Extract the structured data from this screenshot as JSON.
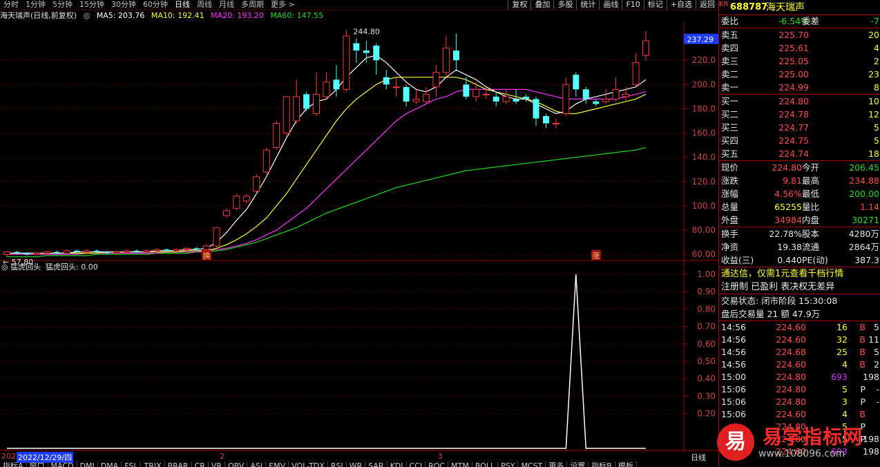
{
  "toolbar": {
    "periods": [
      "分时",
      "1分钟",
      "5分钟",
      "15分钟",
      "30分钟",
      "60分钟",
      "日线",
      "周线",
      "月线",
      "多周期",
      "更多 >"
    ],
    "active_period": "日线",
    "right_buttons": [
      "复权",
      "叠加",
      "多股",
      "统计",
      "画线",
      "F10",
      "标记",
      "+自选",
      "返回"
    ]
  },
  "ma_header": {
    "title": "海天瑞声(日线,前复权)",
    "ma5": "MA5: 203.76",
    "ma10": "MA10: 192.41",
    "ma20": "MA20: 193.20",
    "ma60": "MA60: 147.55",
    "colors": {
      "ma5": "#ffffff",
      "ma10": "#ffff33",
      "ma20": "#ff33ff",
      "ma60": "#22dd22"
    }
  },
  "chart_data": {
    "type": "candlestick",
    "y_axis_ticks": [
      "220.0",
      "200.0",
      "180.0",
      "160.0",
      "140.0",
      "120.0",
      "100.0",
      "80.00",
      "60.00"
    ],
    "current_price_tag": "237.29",
    "high_label": "244.80",
    "low_label": "57.80",
    "markers": [
      "换",
      "涨"
    ],
    "candles": [
      [
        60,
        62,
        57.8,
        63
      ],
      [
        62,
        61,
        60,
        63
      ],
      [
        61,
        60,
        59,
        62
      ],
      [
        60,
        61,
        59,
        62
      ],
      [
        61,
        62,
        60,
        63
      ],
      [
        62,
        61,
        60,
        63
      ],
      [
        61,
        63,
        60,
        64
      ],
      [
        63,
        62,
        61,
        64
      ],
      [
        62,
        63,
        61,
        64
      ],
      [
        63,
        62,
        61,
        64
      ],
      [
        62,
        61,
        60,
        63
      ],
      [
        61,
        62,
        60,
        63
      ],
      [
        62,
        63,
        61,
        64
      ],
      [
        63,
        62,
        61,
        64
      ],
      [
        62,
        63,
        61,
        64
      ],
      [
        63,
        64,
        62,
        65
      ],
      [
        64,
        63,
        62,
        65
      ],
      [
        63,
        64,
        62,
        65
      ],
      [
        64,
        65,
        63,
        66
      ],
      [
        65,
        64,
        63,
        66
      ],
      [
        64,
        67,
        63,
        68
      ],
      [
        67,
        82,
        66,
        82
      ],
      [
        92,
        96,
        90,
        98
      ],
      [
        98,
        108,
        96,
        110
      ],
      [
        104,
        108,
        102,
        110
      ],
      [
        112,
        124,
        110,
        126
      ],
      [
        128,
        146,
        126,
        148
      ],
      [
        148,
        168,
        146,
        170
      ],
      [
        160,
        190,
        158,
        190
      ],
      [
        170,
        190,
        168,
        204
      ],
      [
        192,
        180,
        178,
        194
      ],
      [
        176,
        192,
        174,
        210
      ],
      [
        190,
        202,
        188,
        210
      ],
      [
        204,
        196,
        190,
        216
      ],
      [
        196,
        240,
        194,
        244.8
      ],
      [
        234,
        228,
        218,
        238
      ],
      [
        228,
        226,
        218,
        236
      ],
      [
        232,
        220,
        208,
        234
      ],
      [
        206,
        200,
        196,
        212
      ],
      [
        198,
        198,
        190,
        206
      ],
      [
        198,
        186,
        182,
        200
      ],
      [
        186,
        188,
        184,
        196
      ],
      [
        186,
        192,
        184,
        198
      ],
      [
        198,
        210,
        190,
        216
      ],
      [
        210,
        230,
        206,
        240
      ],
      [
        228,
        220,
        212,
        242
      ],
      [
        200,
        190,
        188,
        206
      ],
      [
        190,
        196,
        186,
        202
      ],
      [
        192,
        192,
        188,
        198
      ],
      [
        190,
        186,
        182,
        194
      ],
      [
        186,
        190,
        184,
        196
      ],
      [
        188,
        186,
        184,
        196
      ],
      [
        190,
        188,
        186,
        192
      ],
      [
        188,
        172,
        166,
        190
      ],
      [
        174,
        168,
        164,
        176
      ],
      [
        168,
        168,
        164,
        172
      ],
      [
        176,
        200,
        174,
        206
      ],
      [
        208,
        196,
        190,
        210
      ],
      [
        196,
        188,
        184,
        198
      ],
      [
        186,
        184,
        182,
        188
      ],
      [
        186,
        188,
        184,
        196
      ],
      [
        188,
        196,
        186,
        206
      ],
      [
        190,
        192,
        186,
        198
      ],
      [
        200,
        218,
        198,
        226
      ],
      [
        224,
        236,
        220,
        244
      ]
    ],
    "ma5": [
      61,
      61,
      61,
      61,
      61,
      61,
      61,
      62,
      62,
      62,
      62,
      62,
      62,
      62,
      62,
      63,
      63,
      63,
      64,
      64,
      65,
      70,
      78,
      88,
      97,
      110,
      124,
      140,
      156,
      170,
      180,
      186,
      188,
      196,
      206,
      214,
      222,
      224,
      218,
      210,
      202,
      196,
      194,
      198,
      206,
      212,
      208,
      204,
      198,
      194,
      190,
      188,
      188,
      184,
      180,
      176,
      178,
      184,
      188,
      190,
      192,
      194,
      196,
      198,
      204
    ],
    "ma10": [
      61,
      61,
      61,
      61,
      61,
      61,
      61,
      61,
      61,
      61,
      62,
      62,
      62,
      62,
      62,
      62,
      62,
      62,
      63,
      63,
      63,
      65,
      68,
      72,
      77,
      83,
      90,
      100,
      110,
      122,
      134,
      146,
      158,
      170,
      180,
      188,
      194,
      200,
      204,
      206,
      206,
      206,
      206,
      206,
      206,
      206,
      204,
      200,
      196,
      194,
      192,
      190,
      188,
      186,
      182,
      178,
      176,
      176,
      178,
      180,
      182,
      184,
      186,
      188,
      192
    ],
    "ma20": [
      60,
      60,
      60,
      60,
      60,
      60,
      60,
      60,
      61,
      61,
      61,
      61,
      61,
      61,
      61,
      61,
      62,
      62,
      62,
      62,
      63,
      64,
      65,
      67,
      69,
      72,
      76,
      80,
      86,
      92,
      98,
      106,
      114,
      122,
      130,
      138,
      146,
      154,
      162,
      170,
      176,
      180,
      184,
      188,
      190,
      194,
      196,
      196,
      196,
      196,
      196,
      196,
      196,
      194,
      192,
      190,
      188,
      188,
      188,
      188,
      188,
      188,
      190,
      192,
      194
    ],
    "ma60": [
      58,
      58,
      58,
      58,
      59,
      59,
      59,
      59,
      59,
      60,
      60,
      60,
      60,
      60,
      60,
      61,
      61,
      61,
      61,
      62,
      62,
      63,
      64,
      66,
      68,
      70,
      73,
      76,
      79,
      82,
      86,
      90,
      94,
      97,
      100,
      103,
      106,
      109,
      112,
      115,
      117,
      119,
      121,
      123,
      125,
      127,
      129,
      130,
      131,
      132,
      133,
      134,
      135,
      136,
      137,
      138,
      139,
      140,
      141,
      142,
      143,
      144,
      145,
      146,
      148
    ]
  },
  "indicator": {
    "title": "猛虎回头",
    "value_label": "猛虎回头: 0.00",
    "y_ticks": [
      "1.00",
      "0.90",
      "0.80",
      "0.70",
      "0.60",
      "0.50",
      "0.40",
      "0.30",
      "0.20"
    ],
    "values": [
      0,
      0,
      0,
      0,
      0,
      0,
      0,
      0,
      0,
      0,
      0,
      0,
      0,
      0,
      0,
      0,
      0,
      0,
      0,
      0,
      0,
      0,
      0,
      0,
      0,
      0,
      0,
      0,
      0,
      0,
      0,
      0,
      0,
      0,
      0,
      0,
      0,
      0,
      0,
      0,
      0,
      0,
      0,
      0,
      0,
      0,
      0,
      0,
      0,
      0,
      0,
      0,
      0,
      0,
      0,
      0,
      0,
      1,
      0,
      0,
      0,
      0,
      0,
      0,
      0
    ]
  },
  "bottom": {
    "date_prefix": "202",
    "date": "2022/12/29/四",
    "month_labels": [
      "2",
      "3"
    ],
    "period_btn": "日线",
    "tabs": [
      "指标A",
      "窗口",
      "MACD",
      "DMI",
      "DMA",
      "FSL",
      "TRIX",
      "BRAR",
      "CR",
      "VR",
      "OBV",
      "ASI",
      "EMV",
      "VOL-TDX",
      "RSI",
      "WR",
      "SAR",
      "KDJ",
      "CCI",
      "ROC",
      "MTM",
      "BOLL",
      "PSY",
      "MCST",
      "更多",
      "设置",
      "指标B",
      "模板"
    ]
  },
  "quote": {
    "code": "688787",
    "name": "海天瑞声",
    "badge": "KR",
    "weibi_label": "委比",
    "weibi": "-6.54%",
    "weicha_label": "委差",
    "weicha": "-7",
    "sells": [
      {
        "label": "卖五",
        "price": "225.70",
        "vol": "20"
      },
      {
        "label": "卖四",
        "price": "225.61",
        "vol": "4"
      },
      {
        "label": "卖三",
        "price": "225.05",
        "vol": "2"
      },
      {
        "label": "卖二",
        "price": "225.00",
        "vol": "23"
      },
      {
        "label": "卖一",
        "price": "224.99",
        "vol": "8"
      }
    ],
    "buys": [
      {
        "label": "买一",
        "price": "224.80",
        "vol": "10"
      },
      {
        "label": "买二",
        "price": "224.78",
        "vol": "12"
      },
      {
        "label": "买三",
        "price": "224.77",
        "vol": "5"
      },
      {
        "label": "买四",
        "price": "224.75",
        "vol": "5"
      },
      {
        "label": "买五",
        "price": "224.74",
        "vol": "18"
      }
    ],
    "stats": [
      {
        "l1": "现价",
        "v1": "224.80",
        "c1": "red",
        "l2": "今开",
        "v2": "206.45",
        "c2": "green"
      },
      {
        "l1": "涨跌",
        "v1": "9.81",
        "c1": "red",
        "l2": "最高",
        "v2": "234.88",
        "c2": "red"
      },
      {
        "l1": "涨幅",
        "v1": "4.56%",
        "c1": "red",
        "l2": "最低",
        "v2": "200.00",
        "c2": "green"
      },
      {
        "l1": "总量",
        "v1": "65255",
        "c1": "yellow",
        "l2": "量比",
        "v2": "1.14",
        "c2": "red"
      },
      {
        "l1": "外盘",
        "v1": "34984",
        "c1": "red",
        "l2": "内盘",
        "v2": "30271",
        "c2": "green"
      }
    ],
    "stats2": [
      {
        "l1": "换手",
        "v1": "22.78%",
        "l2": "股本",
        "v2": "4280万"
      },
      {
        "l1": "净资",
        "v1": "19.38",
        "l2": "流通",
        "v2": "2864万"
      },
      {
        "l1": "收益(三)",
        "v1": "0.440",
        "l2": "PE(动)",
        "v2": "387.3"
      }
    ],
    "promo1": "通达信，仅需1元查看千档行情",
    "promo2": "注册制 已盈利 表决权无差异",
    "trade_state": "交易状态: 闭市阶段 15:30:08",
    "after_hours": "盘后交易量 21 额 47.9万",
    "ticks": [
      {
        "t": "14:56",
        "p": "224.60",
        "v": "16",
        "f": "B",
        "n": "5"
      },
      {
        "t": "14:56",
        "p": "224.60",
        "v": "32",
        "f": "B",
        "n": "11"
      },
      {
        "t": "14:56",
        "p": "224.68",
        "v": "25",
        "f": "B",
        "n": "5"
      },
      {
        "t": "14:56",
        "p": "224.60",
        "v": "4",
        "f": "B",
        "n": "2"
      },
      {
        "t": "15:00",
        "p": "224.80",
        "v": "693",
        "f": "",
        "n": "198"
      },
      {
        "t": "15:06",
        "p": "224.80",
        "v": "5",
        "f": "P",
        "n": "-"
      },
      {
        "t": "15:06",
        "p": "224.80",
        "v": "3",
        "f": "P",
        "n": "-"
      },
      {
        "t": "15:06",
        "p": "224.60",
        "v": "4",
        "f": "B",
        "n": ""
      },
      {
        "t": "",
        "p": "224.80",
        "v": "5",
        "f": "P",
        "n": ""
      },
      {
        "t": "",
        "p": "224.80",
        "v": "5",
        "f": "P",
        "n": "198"
      },
      {
        "t": "",
        "p": "224.60",
        "v": "693",
        "f": "",
        "n": "198"
      }
    ]
  },
  "watermark": {
    "glyph": "易",
    "brand": "易学指标网",
    "url": "www.108096.com"
  }
}
